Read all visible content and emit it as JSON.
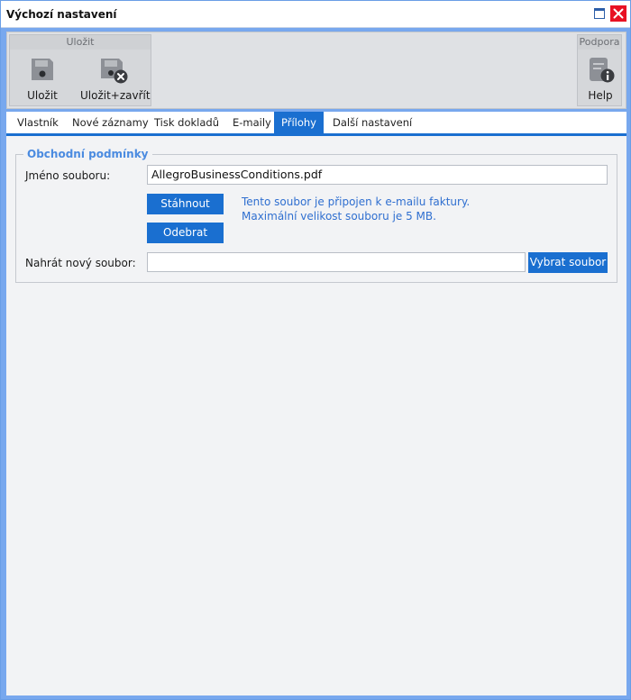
{
  "window": {
    "title": "Výchozí nastavení"
  },
  "ribbon": {
    "save_group_title": "Uložit",
    "save_label": "Uložit",
    "save_close_label": "Uložit+zavřít",
    "support_group_title": "Podpora",
    "help_label": "Help"
  },
  "tabs": [
    {
      "label": "Vlastník"
    },
    {
      "label": "Nové záznamy"
    },
    {
      "label": "Tisk dokladů"
    },
    {
      "label": "E-maily"
    },
    {
      "label": "Přílohy",
      "active": true
    },
    {
      "label": "Další nastavení"
    }
  ],
  "form": {
    "section_title": "Obchodní podmínky",
    "filename_label": "Jméno souboru:",
    "filename_value": "AllegroBusinessConditions.pdf",
    "download_label": "Stáhnout",
    "remove_label": "Odebrat",
    "info_line1": "Tento soubor je připojen k e-mailu faktury.",
    "info_line2": "Maximální velikost souboru je 5 MB.",
    "upload_label": "Nahrát nový soubor:",
    "upload_value": "",
    "choose_file_label": "Vybrat soubor"
  },
  "colors": {
    "accent": "#1a6fd0",
    "close_button": "#e81123",
    "legend_text": "#4b8be0",
    "info_text": "#2f6fd0"
  },
  "icons": [
    "floppy-disk-icon",
    "floppy-disk-close-icon",
    "help-document-icon",
    "maximize-icon",
    "close-icon"
  ]
}
